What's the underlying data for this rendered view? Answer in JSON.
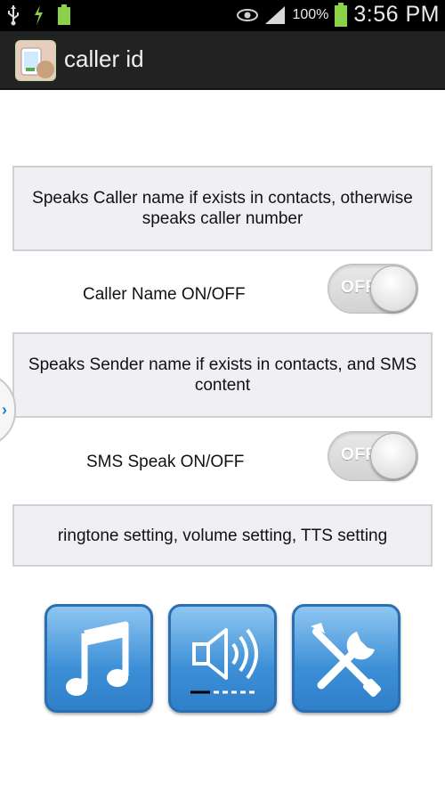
{
  "status_bar": {
    "left_icons": [
      "usb-icon",
      "download-icon",
      "battery-small-icon"
    ],
    "battery_percent": "100%",
    "time": "3:56 PM"
  },
  "action_bar": {
    "title": "caller id"
  },
  "caller_section": {
    "description": "Speaks Caller name if exists in contacts, otherwise speaks caller number",
    "toggle_label": "Caller Name ON/OFF",
    "toggle_state": "OFF"
  },
  "sms_section": {
    "description": "Speaks Sender name if exists in contacts, and SMS content",
    "toggle_label": "SMS Speak ON/OFF",
    "toggle_state": "OFF"
  },
  "settings_section": {
    "description": "ringtone setting, volume setting, TTS setting",
    "buttons": [
      {
        "icon": "music-note-icon"
      },
      {
        "icon": "speaker-volume-icon"
      },
      {
        "icon": "tools-icon"
      }
    ]
  },
  "side_tab": {
    "glyph": "›"
  },
  "colors": {
    "accent_blue": "#3c8fd6",
    "panel_bg": "#efeff4",
    "actionbar_bg": "#222222"
  }
}
